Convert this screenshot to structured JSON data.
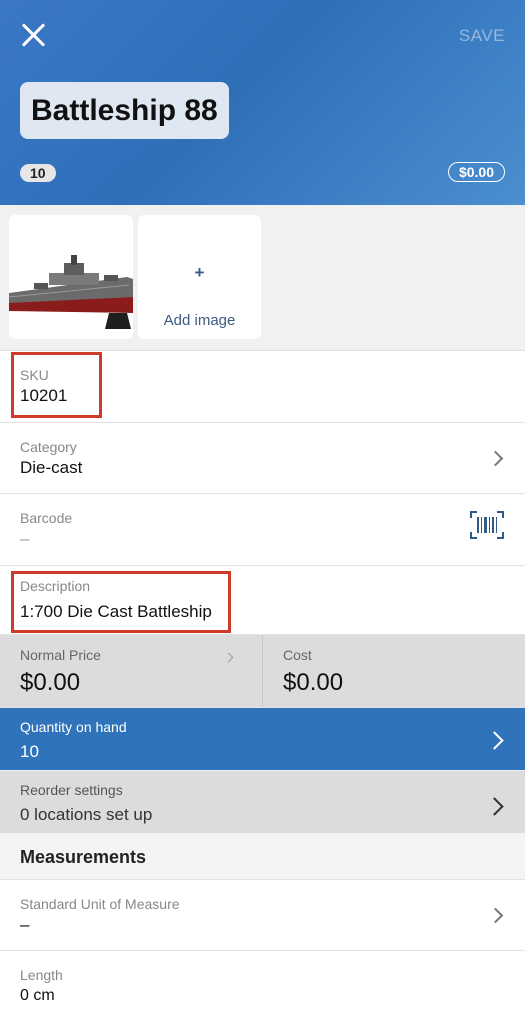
{
  "header": {
    "save_label": "SAVE",
    "title": "Battleship 88",
    "qty_badge": "10",
    "price_badge": "$0.00"
  },
  "images": {
    "add_label": "Add image",
    "plus": "+"
  },
  "fields": {
    "sku": {
      "label": "SKU",
      "value": "10201"
    },
    "category": {
      "label": "Category",
      "value": "Die-cast"
    },
    "barcode": {
      "label": "Barcode",
      "value": "–"
    },
    "description": {
      "label": "Description",
      "value": "1:700 Die Cast Battleship"
    },
    "normal_price": {
      "label": "Normal Price",
      "value": "$0.00"
    },
    "cost": {
      "label": "Cost",
      "value": "$0.00"
    },
    "quantity": {
      "label": "Quantity on hand",
      "value": "10"
    },
    "reorder": {
      "label": "Reorder settings",
      "value": "0 locations set up"
    },
    "measurements_header": "Measurements",
    "uom": {
      "label": "Standard Unit of Measure",
      "value": "–"
    },
    "length": {
      "label": "Length",
      "value": "0 cm"
    }
  },
  "colors": {
    "header_blue": "#2f6fb8",
    "highlight_red": "#cf3b2b",
    "quantity_blue": "#2f74bb"
  }
}
